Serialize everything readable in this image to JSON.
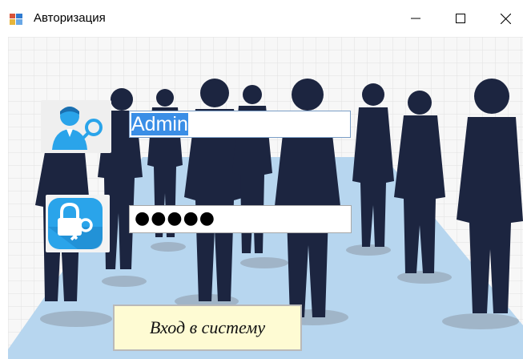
{
  "window": {
    "title": "Авторизация",
    "controls": {
      "minimize": "minimize",
      "maximize": "maximize",
      "close": "close"
    }
  },
  "login": {
    "user_icon": "user-key-icon",
    "value": "Admin",
    "selected": true
  },
  "password": {
    "lock_icon": "lock-key-icon",
    "masked_value": "●●●●●"
  },
  "submit": {
    "label": "Вход в систему"
  },
  "colors": {
    "silhouette": "#1c2540",
    "floor": "#b7d6ef",
    "selection": "#3a8ee6",
    "button_bg": "#fefbd3",
    "icon_blue": "#2aa4ea"
  }
}
